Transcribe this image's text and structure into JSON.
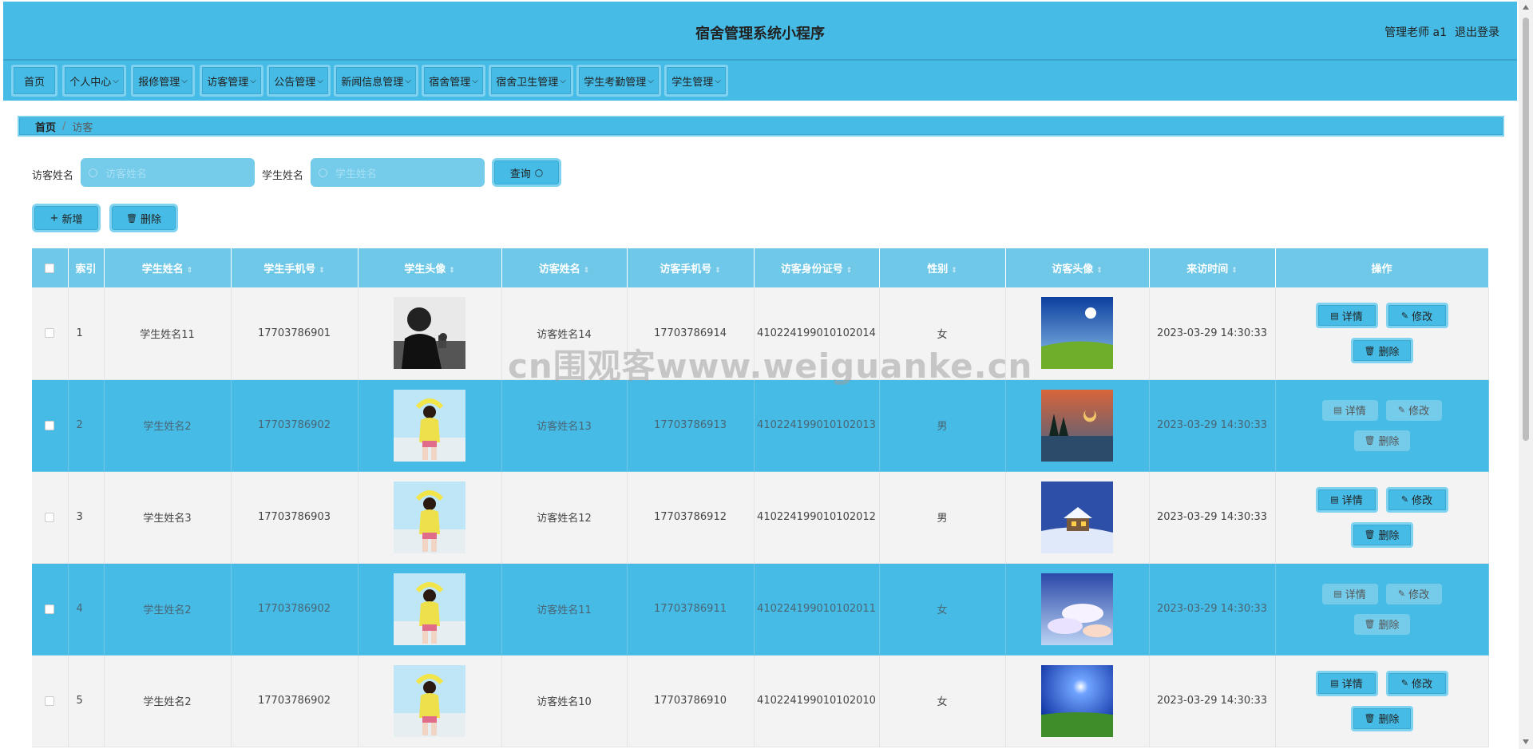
{
  "header": {
    "title": "宿舍管理系统小程序",
    "user": "管理老师 a1",
    "logout": "退出登录"
  },
  "nav": [
    {
      "label": "首页",
      "caret": ""
    },
    {
      "label": "个人中心",
      "caret": "⌵"
    },
    {
      "label": "报修管理",
      "caret": "⌵"
    },
    {
      "label": "访客管理",
      "caret": "⌵"
    },
    {
      "label": "公告管理",
      "caret": "⌵"
    },
    {
      "label": "新闻信息管理",
      "caret": "⌵"
    },
    {
      "label": "宿舍管理",
      "caret": "⌵"
    },
    {
      "label": "宿舍卫生管理",
      "caret": "⌵"
    },
    {
      "label": "学生考勤管理",
      "caret": "⌵"
    },
    {
      "label": "学生管理",
      "caret": "⌵"
    }
  ],
  "breadcrumb": {
    "home": "首页",
    "sep": "/",
    "current": "访客"
  },
  "search": {
    "visitor_label": "访客姓名",
    "visitor_placeholder": "访客姓名",
    "student_label": "学生姓名",
    "student_placeholder": "学生姓名",
    "query_button": "查询"
  },
  "actions": {
    "add": "新增",
    "delete": "删除"
  },
  "table": {
    "headers": [
      "索引",
      "学生姓名",
      "学生手机号",
      "学生头像",
      "访客姓名",
      "访客手机号",
      "访客身份证号",
      "性别",
      "访客头像",
      "来访时间",
      "操作"
    ],
    "rows": [
      {
        "index": "1",
        "student_name": "学生姓名11",
        "student_phone": "17703786901",
        "student_avatar": "man-silhouette",
        "visitor_name": "访客姓名14",
        "visitor_phone": "17703786914",
        "visitor_id": "410224199010102014",
        "gender": "女",
        "visitor_avatar": "sunny-meadow",
        "time": "2023-03-29 14:30:33"
      },
      {
        "index": "2",
        "student_name": "学生姓名2",
        "student_phone": "17703786902",
        "student_avatar": "girl-yellow",
        "visitor_name": "访客姓名13",
        "visitor_phone": "17703786913",
        "visitor_id": "410224199010102013",
        "gender": "男",
        "visitor_avatar": "lake-dusk",
        "time": "2023-03-29 14:30:33"
      },
      {
        "index": "3",
        "student_name": "学生姓名3",
        "student_phone": "17703786903",
        "student_avatar": "girl-yellow",
        "visitor_name": "访客姓名12",
        "visitor_phone": "17703786912",
        "visitor_id": "410224199010102012",
        "gender": "男",
        "visitor_avatar": "snow-cabin",
        "time": "2023-03-29 14:30:33"
      },
      {
        "index": "4",
        "student_name": "学生姓名2",
        "student_phone": "17703786902",
        "student_avatar": "girl-yellow",
        "visitor_name": "访客姓名11",
        "visitor_phone": "17703786911",
        "visitor_id": "410224199010102011",
        "gender": "女",
        "visitor_avatar": "cloud-sky",
        "time": "2023-03-29 14:30:33"
      },
      {
        "index": "5",
        "student_name": "学生姓名2",
        "student_phone": "17703786902",
        "student_avatar": "girl-yellow",
        "visitor_name": "访客姓名10",
        "visitor_phone": "17703786910",
        "visitor_id": "410224199010102010",
        "gender": "女",
        "visitor_avatar": "night-meadow",
        "time": "2023-03-29 14:30:33"
      }
    ],
    "op_labels": {
      "detail": "详情",
      "edit": "修改",
      "delete": "删除"
    }
  },
  "watermark": "cn围观客www.weiguanke.cn",
  "colors": {
    "primary": "#45bbe5",
    "header_cell": "#6fc8e8",
    "input": "#74cbea"
  }
}
